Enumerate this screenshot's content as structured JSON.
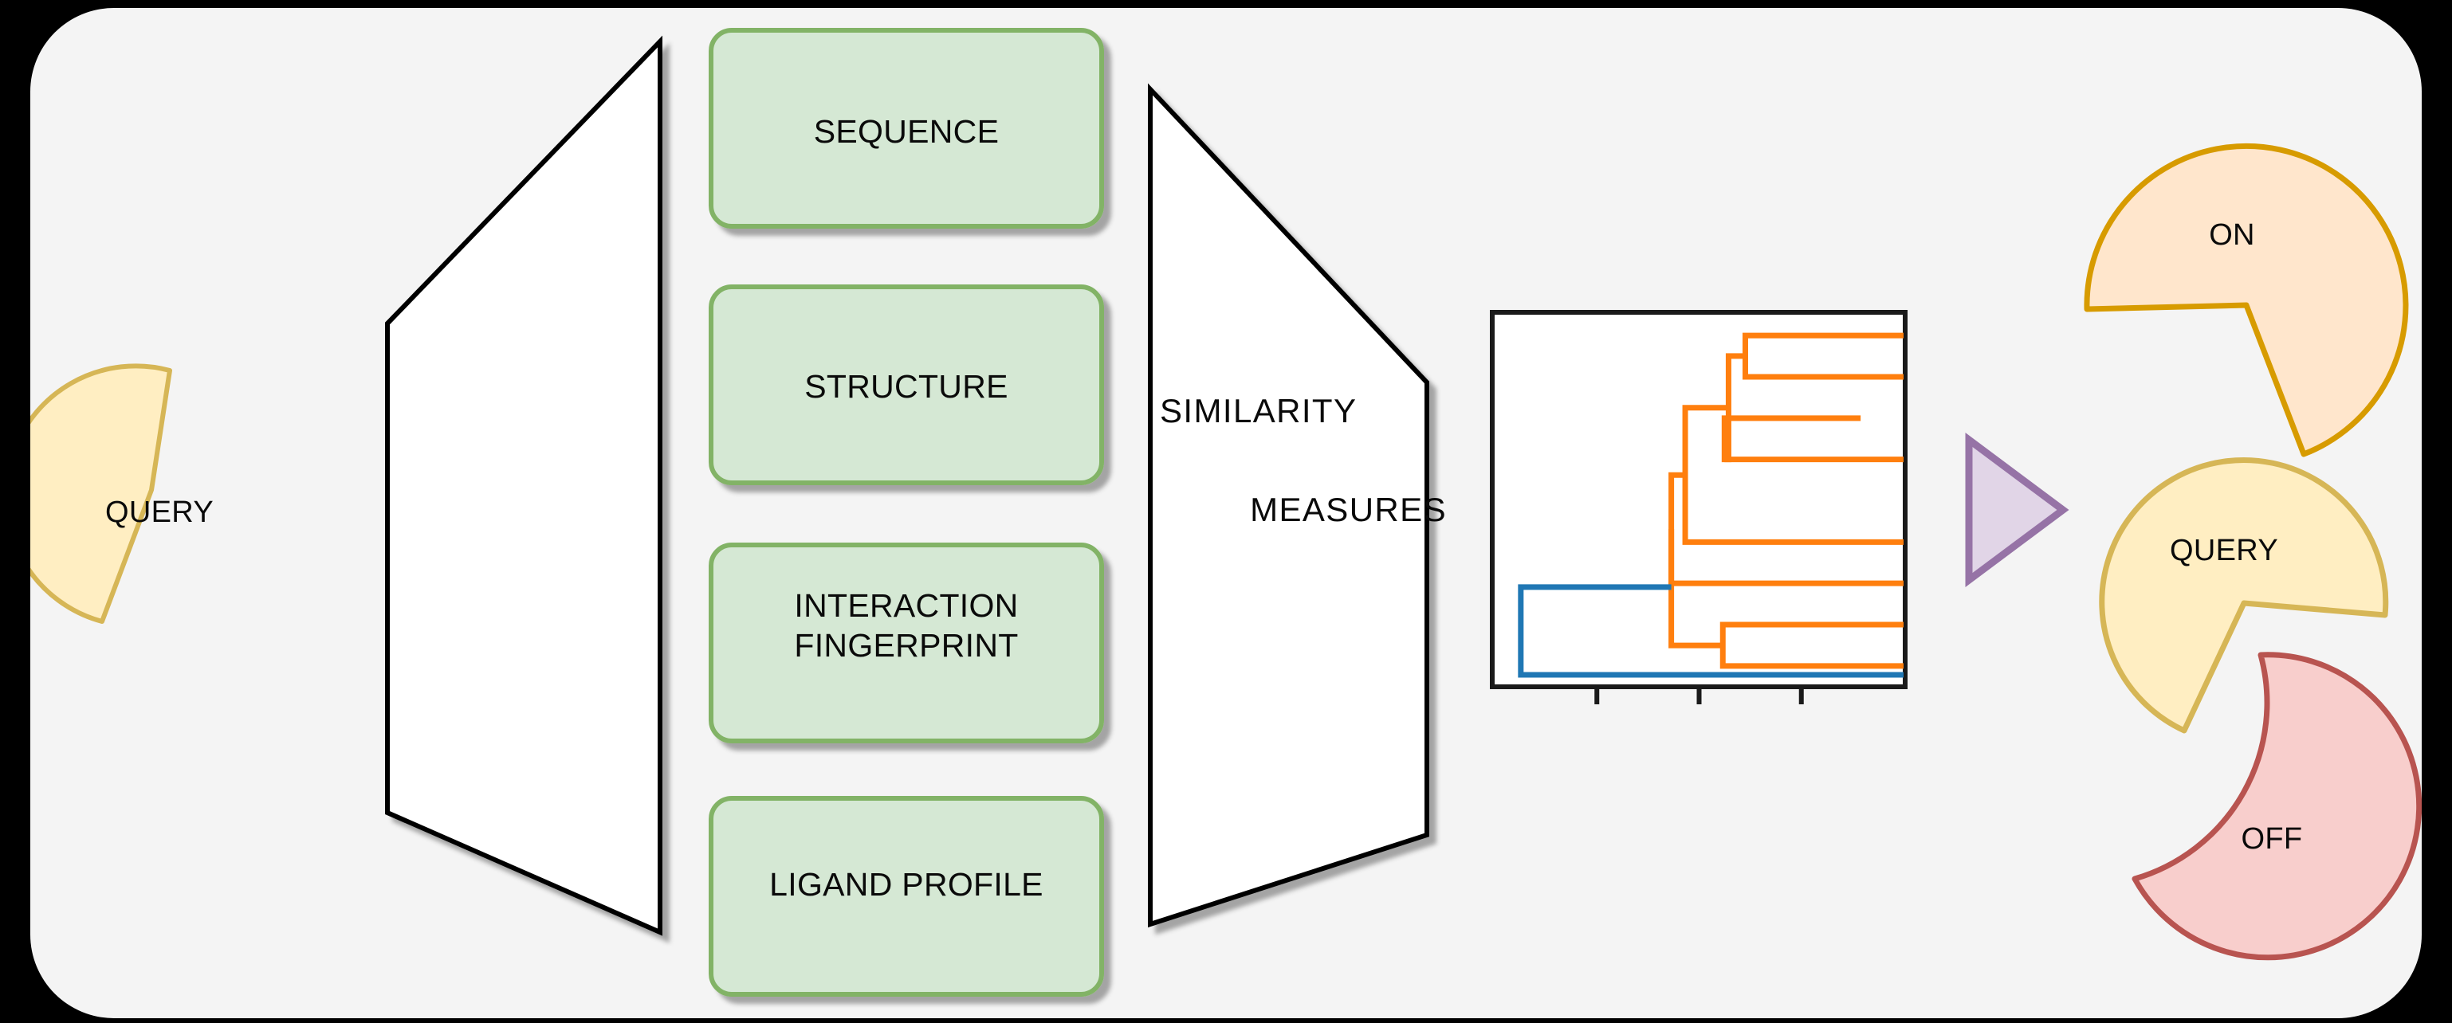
{
  "canvas": {
    "background": "#f4f4f4",
    "outer_background": "#000000",
    "corner_radius_px": 105
  },
  "diagram": {
    "title": "",
    "input": {
      "label": "QUERY",
      "shape": "pie-with-wedge-cut",
      "fill": "#ffeec2",
      "stroke": "#d6b656"
    },
    "funnel_left": {
      "label": "",
      "shape": "trapezoid-left",
      "fill": "#ffffff",
      "stroke": "#000000"
    },
    "descriptors": [
      {
        "label": "SEQUENCE",
        "fill": "#d5e8d4",
        "stroke": "#82b366"
      },
      {
        "label": "STRUCTURE",
        "fill": "#d5e8d4",
        "stroke": "#82b366"
      },
      {
        "label": "INTERACTION\nFINGERPRINT",
        "fill": "#d5e8d4",
        "stroke": "#82b366"
      },
      {
        "label": "LIGAND PROFILE",
        "fill": "#d5e8d4",
        "stroke": "#82b366"
      }
    ],
    "funnel_right": {
      "label_line1": "SIMILARITY",
      "label_line2": "MEASURES",
      "shape": "trapezoid-right",
      "fill": "#ffffff",
      "stroke": "#000000"
    },
    "dendrogram_panel": {
      "name": "dendrogram",
      "fill": "#ffffff",
      "stroke": "#1a1a1a"
    },
    "arrow": {
      "shape": "triangle-right",
      "fill": "#e1d5e7",
      "stroke": "#9673a6"
    },
    "outputs": [
      {
        "label": "ON",
        "shape": "pie-with-wedge-cut",
        "fill": "#ffe6cc",
        "stroke": "#d79b00"
      },
      {
        "label": "QUERY",
        "shape": "pie-with-wedge-cut",
        "fill": "#ffeec2",
        "stroke": "#d6b656"
      },
      {
        "label": "OFF",
        "shape": "crescent",
        "fill": "#f8cecc",
        "stroke": "#b85450"
      }
    ]
  },
  "chart_data": {
    "type": "line",
    "title": "",
    "xlabel": "",
    "ylabel": "",
    "subtype": "dendrogram",
    "orientation": "horizontal",
    "grid": false,
    "legend": false,
    "axis_ticks_x": [
      0.0,
      0.25,
      0.5,
      0.75,
      1.0
    ],
    "axis_tick_labels_x": [
      "",
      "",
      "",
      "",
      ""
    ],
    "colors": {
      "cluster_1": "#ff7f0e",
      "cluster_2": "#1f77b4",
      "axes": "#1a1a1a"
    },
    "leaves": 9,
    "links": [
      {
        "color": "#ff7f0e",
        "y1": 0.944,
        "y2": 0.833,
        "x_merge": 0.613,
        "x1": 1.0,
        "x2": 1.0
      },
      {
        "color": "#ff7f0e",
        "y1": 0.889,
        "y2": 0.611,
        "x_merge": 0.572,
        "x1": 0.613,
        "x2": 0.562
      },
      {
        "color": "#ff7f0e",
        "y1": 0.722,
        "y2": 0.611,
        "x_merge": 0.562,
        "x1": 0.895,
        "x2": 1.0
      },
      {
        "color": "#ff7f0e",
        "y1": 0.75,
        "y2": 0.389,
        "x_merge": 0.466,
        "x1": 0.572,
        "x2": 1.0
      },
      {
        "color": "#ff7f0e",
        "y1": 0.569,
        "y2": 0.278,
        "x_merge": 0.432,
        "x1": 0.466,
        "x2": 1.0
      },
      {
        "color": "#ff7f0e",
        "y1": 0.167,
        "y2": 0.056,
        "x_merge": 0.558,
        "x1": 1.0,
        "x2": 1.0
      },
      {
        "color": "#ff7f0e",
        "y1": 0.424,
        "y2": 0.111,
        "x_merge": 0.432,
        "x1": 0.432,
        "x2": 0.558
      },
      {
        "color": "#1f77b4",
        "y1": 0.268,
        "y2": 0.032,
        "x_merge": 0.064,
        "x1": 0.432,
        "x2": 1.0
      }
    ]
  }
}
